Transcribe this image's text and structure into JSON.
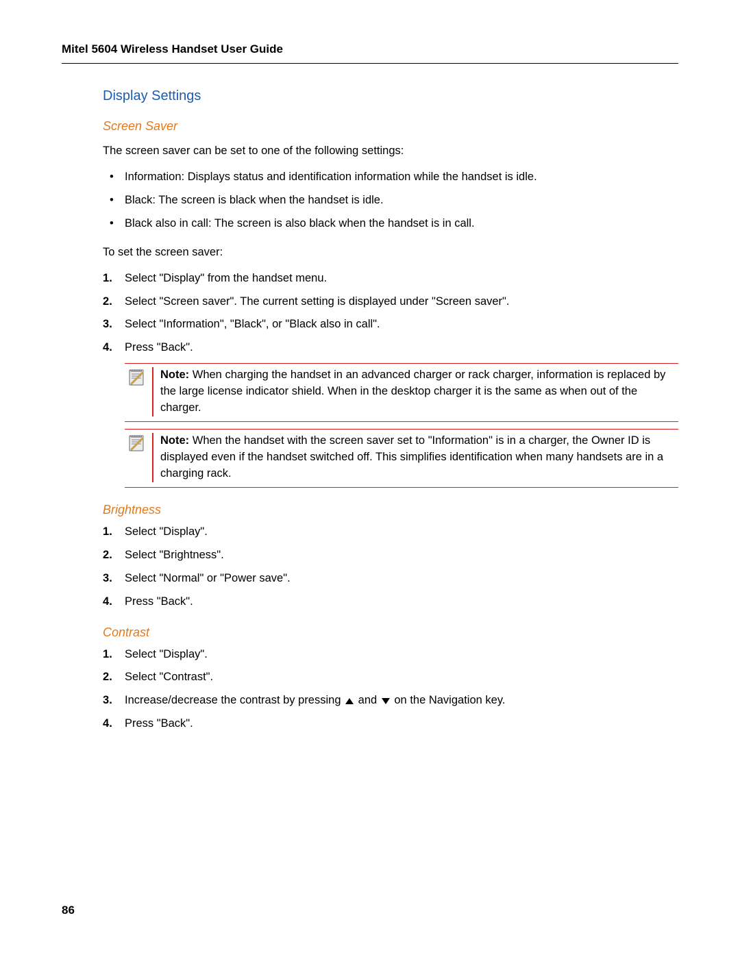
{
  "header": {
    "title": "Mitel 5604 Wireless Handset User Guide"
  },
  "page_number": "86",
  "section": {
    "h2": "Display Settings",
    "screen_saver": {
      "h3": "Screen Saver",
      "intro": "The screen saver can be set to one of the following settings:",
      "bullets": [
        "Information: Displays status and identification information while the handset is idle.",
        "Black: The screen is black when the handset is idle.",
        "Black also in call: The screen is also black when the handset is in call."
      ],
      "to_set": "To set the screen saver:",
      "steps": [
        "Select \"Display\" from the handset menu.",
        "Select \"Screen saver\". The current setting is displayed under \"Screen saver\".",
        "Select \"Information\", \"Black\", or \"Black also in call\".",
        "Press \"Back\"."
      ],
      "note1_label": "Note:",
      "note1_body": " When charging the handset in an advanced charger or rack charger, information is replaced by the large license indicator shield. When in the desktop charger it is the same as when out of the charger.",
      "note2_label": "Note:",
      "note2_body": " When the handset with the screen saver set to \"Information\" is in a charger, the Owner ID is displayed even if the handset switched off. This simplifies identification when many handsets are in a charging rack."
    },
    "brightness": {
      "h3": "Brightness",
      "steps": [
        "Select \"Display\".",
        "Select \"Brightness\".",
        "Select \"Normal\" or \"Power save\".",
        "Press \"Back\"."
      ]
    },
    "contrast": {
      "h3": "Contrast",
      "steps": [
        "Select \"Display\".",
        "Select \"Contrast\".",
        "Increase/decrease the contrast by pressing __UP__ and __DOWN__ on the Navigation key.",
        "Press \"Back\"."
      ]
    }
  }
}
